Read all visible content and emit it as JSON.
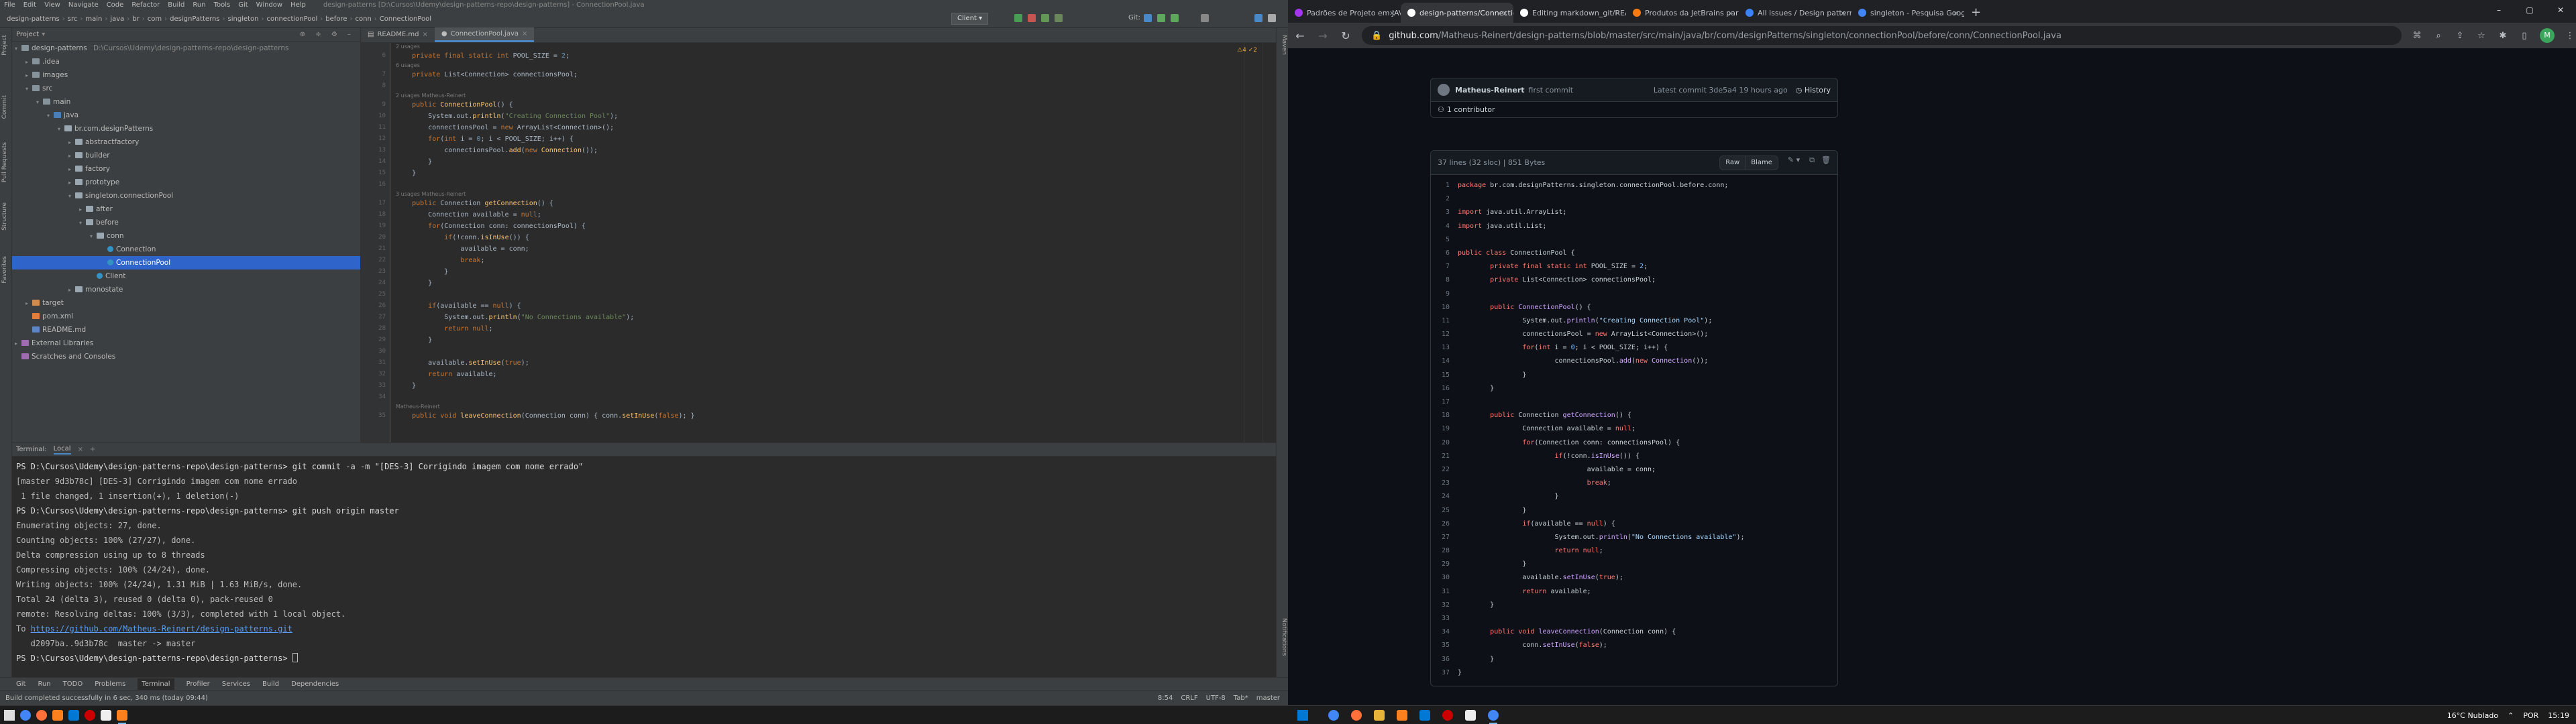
{
  "ide": {
    "menu": [
      "File",
      "Edit",
      "View",
      "Navigate",
      "Code",
      "Refactor",
      "Build",
      "Run",
      "Tools",
      "Git",
      "Window",
      "Help"
    ],
    "title": "design-patterns [D:\\Cursos\\Udemy\\design-patterns-repo\\design-patterns] - ConnectionPool.java",
    "breadcrumb": [
      "design-patterns",
      "src",
      "main",
      "java",
      "br",
      "com",
      "designPatterns",
      "singleton",
      "connectionPool",
      "before",
      "conn",
      "ConnectionPool"
    ],
    "run_config": "Client",
    "git_label": "Git:",
    "left_tabs": [
      "Project",
      "Commit",
      "Pull Requests",
      "Structure",
      "Favorites"
    ],
    "right_tabs": [
      "Maven",
      "Notifications"
    ],
    "project_header": "Project",
    "tree": [
      {
        "label": "design-patterns",
        "extra": "D:\\Cursos\\Udemy\\design-patterns-repo\\design-patterns",
        "indent": 0,
        "type": "fold",
        "arrow": "▾"
      },
      {
        "label": ".idea",
        "indent": 1,
        "type": "fold",
        "arrow": "▸"
      },
      {
        "label": "images",
        "indent": 1,
        "type": "fold",
        "arrow": "▸"
      },
      {
        "label": "src",
        "indent": 1,
        "type": "fold",
        "arrow": "▾"
      },
      {
        "label": "main",
        "indent": 2,
        "type": "fold",
        "arrow": "▾"
      },
      {
        "label": "java",
        "indent": 3,
        "type": "fold-src",
        "arrow": "▾"
      },
      {
        "label": "br.com.designPatterns",
        "indent": 4,
        "type": "fold-pkg",
        "arrow": "▾"
      },
      {
        "label": "abstractfactory",
        "indent": 5,
        "type": "fold-pkg",
        "arrow": "▸"
      },
      {
        "label": "builder",
        "indent": 5,
        "type": "fold-pkg",
        "arrow": "▸"
      },
      {
        "label": "factory",
        "indent": 5,
        "type": "fold-pkg",
        "arrow": "▸"
      },
      {
        "label": "prototype",
        "indent": 5,
        "type": "fold-pkg",
        "arrow": "▸"
      },
      {
        "label": "singleton.connectionPool",
        "indent": 5,
        "type": "fold-pkg",
        "arrow": "▾"
      },
      {
        "label": "after",
        "indent": 6,
        "type": "fold-pkg",
        "arrow": "▸"
      },
      {
        "label": "before",
        "indent": 6,
        "type": "fold-pkg",
        "arrow": "▾"
      },
      {
        "label": "conn",
        "indent": 7,
        "type": "fold-pkg",
        "arrow": "▾"
      },
      {
        "label": "Connection",
        "indent": 8,
        "type": "cls",
        "arrow": ""
      },
      {
        "label": "ConnectionPool",
        "indent": 8,
        "type": "cls",
        "arrow": "",
        "selected": true
      },
      {
        "label": "Client",
        "indent": 7,
        "type": "cls",
        "arrow": ""
      },
      {
        "label": "monostate",
        "indent": 5,
        "type": "fold-pkg",
        "arrow": "▸"
      },
      {
        "label": "target",
        "indent": 1,
        "type": "fold-tgt",
        "arrow": "▸"
      },
      {
        "label": "pom.xml",
        "indent": 1,
        "type": "xml",
        "arrow": ""
      },
      {
        "label": "README.md",
        "indent": 1,
        "type": "md",
        "arrow": ""
      },
      {
        "label": "External Libraries",
        "indent": 0,
        "type": "lib",
        "arrow": "▸"
      },
      {
        "label": "Scratches and Consoles",
        "indent": 0,
        "type": "lib",
        "arrow": ""
      }
    ],
    "editor_tabs": [
      {
        "label": "README.md",
        "active": false
      },
      {
        "label": "ConnectionPool.java",
        "active": true
      }
    ],
    "inspections": "⚠4 ✓2",
    "terminal": {
      "tabs": [
        "Terminal:",
        "Local"
      ],
      "lines": [
        "PS D:\\Cursos\\Udemy\\design-patterns-repo\\design-patterns> git commit -a -m \"[DES-3] Corrigindo imagem com nome errado\"",
        "[master 9d3b78c] [DES-3] Corrigindo imagem com nome errado",
        " 1 file changed, 1 insertion(+), 1 deletion(-)",
        "PS D:\\Cursos\\Udemy\\design-patterns-repo\\design-patterns> git push origin master",
        "Enumerating objects: 27, done.",
        "Counting objects: 100% (27/27), done.",
        "Delta compression using up to 8 threads",
        "Compressing objects: 100% (24/24), done.",
        "Writing objects: 100% (24/24), 1.31 MiB | 1.63 MiB/s, done.",
        "Total 24 (delta 3), reused 0 (delta 0), pack-reused 0",
        "remote: Resolving deltas: 100% (3/3), completed with 1 local object.",
        "",
        "   d2097ba..9d3b78c  master -> master",
        "PS D:\\Cursos\\Udemy\\design-patterns-repo\\design-patterns> "
      ],
      "to_prefix": "To ",
      "to_link": "https://github.com/Matheus-Reinert/design-patterns.git"
    },
    "bottom_tools": [
      "Git",
      "Run",
      "TODO",
      "Problems",
      "Terminal",
      "Profiler",
      "Services",
      "Build",
      "Dependencies"
    ],
    "status": {
      "message": "Build completed successfully in 6 sec, 340 ms (today 09:44)",
      "pos": "8:54",
      "eol": "CRLF",
      "enc": "UTF-8",
      "indent": "Tab*",
      "branch": "master"
    }
  },
  "browser": {
    "tabs": [
      {
        "label": "Padrões de Projeto em JAVA",
        "color": "#a435f0",
        "active": false
      },
      {
        "label": "design-patterns/Connection...",
        "color": "#ffffff",
        "active": true
      },
      {
        "label": "Editing markdown_git/README...",
        "color": "#ffffff",
        "active": false
      },
      {
        "label": "Produtos da JetBrains para...",
        "color": "#f97a12",
        "active": false
      },
      {
        "label": "All issues / Design patterns",
        "color": "#3b82f6",
        "active": false
      },
      {
        "label": "singleton - Pesquisa Google",
        "color": "#4285f4",
        "active": false
      }
    ],
    "url_host": "github.com",
    "url_path": "/Matheus-Reinert/design-patterns/blob/master/src/main/java/br/com/designPatterns/singleton/connectionPool/before/conn/ConnectionPool.java",
    "profile_initial": "M",
    "commit": {
      "author": "Matheus-Reinert",
      "message": "first commit",
      "latest": "Latest commit 3de5a4 19 hours ago",
      "history": "History"
    },
    "contributors": "1 contributor",
    "file_info": "37 lines (32 sloc)   |   851 Bytes",
    "raw": "Raw",
    "blame": "Blame"
  },
  "code_lines": [
    {
      "n": 1,
      "t": "package br.com.designPatterns.singleton.connectionPool.before.conn;"
    },
    {
      "n": 2,
      "t": ""
    },
    {
      "n": 3,
      "t": "import java.util.ArrayList;"
    },
    {
      "n": 4,
      "t": "import java.util.List;"
    },
    {
      "n": 5,
      "t": ""
    },
    {
      "n": 6,
      "t": "public class ConnectionPool {"
    },
    {
      "n": 7,
      "t": "        private final static int POOL_SIZE = 2;"
    },
    {
      "n": 8,
      "t": "        private List<Connection> connectionsPool;"
    },
    {
      "n": 9,
      "t": ""
    },
    {
      "n": 10,
      "t": "        public ConnectionPool() {"
    },
    {
      "n": 11,
      "t": "                System.out.println(\"Creating Connection Pool\");"
    },
    {
      "n": 12,
      "t": "                connectionsPool = new ArrayList<Connection>();"
    },
    {
      "n": 13,
      "t": "                for(int i = 0; i < POOL_SIZE; i++) {"
    },
    {
      "n": 14,
      "t": "                        connectionsPool.add(new Connection());"
    },
    {
      "n": 15,
      "t": "                }"
    },
    {
      "n": 16,
      "t": "        }"
    },
    {
      "n": 17,
      "t": ""
    },
    {
      "n": 18,
      "t": "        public Connection getConnection() {"
    },
    {
      "n": 19,
      "t": "                Connection available = null;"
    },
    {
      "n": 20,
      "t": "                for(Connection conn: connectionsPool) {"
    },
    {
      "n": 21,
      "t": "                        if(!conn.isInUse()) {"
    },
    {
      "n": 22,
      "t": "                                available = conn;"
    },
    {
      "n": 23,
      "t": "                                break;"
    },
    {
      "n": 24,
      "t": "                        }"
    },
    {
      "n": 25,
      "t": "                }"
    },
    {
      "n": 26,
      "t": "                if(available == null) {"
    },
    {
      "n": 27,
      "t": "                        System.out.println(\"No Connections available\");"
    },
    {
      "n": 28,
      "t": "                        return null;"
    },
    {
      "n": 29,
      "t": "                }"
    },
    {
      "n": 30,
      "t": "                available.setInUse(true);"
    },
    {
      "n": 31,
      "t": "                return available;"
    },
    {
      "n": 32,
      "t": "        }"
    },
    {
      "n": 33,
      "t": ""
    },
    {
      "n": 34,
      "t": "        public void leaveConnection(Connection conn) {"
    },
    {
      "n": 35,
      "t": "                conn.setInUse(false);"
    },
    {
      "n": 36,
      "t": "        }"
    },
    {
      "n": 37,
      "t": "}"
    }
  ],
  "ide_code": [
    {
      "n": 6,
      "t": "    private final static int POOL_SIZE = 2;",
      "hint": "2 usages"
    },
    {
      "n": 7,
      "t": "    private List<Connection> connectionsPool;",
      "hint": "6 usages"
    },
    {
      "n": 8,
      "t": ""
    },
    {
      "n": 9,
      "t": "    public ConnectionPool() {",
      "hint": "2 usages   Matheus-Reinert"
    },
    {
      "n": 10,
      "t": "        System.out.println(\"Creating Connection Pool\");"
    },
    {
      "n": 11,
      "t": "        connectionsPool = new ArrayList<Connection>();"
    },
    {
      "n": 12,
      "t": "        for(int i = 0; i < POOL_SIZE; i++) {"
    },
    {
      "n": 13,
      "t": "            connectionsPool.add(new Connection());"
    },
    {
      "n": 14,
      "t": "        }"
    },
    {
      "n": 15,
      "t": "    }"
    },
    {
      "n": 16,
      "t": ""
    },
    {
      "n": 17,
      "t": "    public Connection getConnection() {",
      "hint": "3 usages   Matheus-Reinert"
    },
    {
      "n": 18,
      "t": "        Connection available = null;"
    },
    {
      "n": 19,
      "t": "        for(Connection conn: connectionsPool) {"
    },
    {
      "n": 20,
      "t": "            if(!conn.isInUse()) {"
    },
    {
      "n": 21,
      "t": "                available = conn;"
    },
    {
      "n": 22,
      "t": "                break;"
    },
    {
      "n": 23,
      "t": "            }"
    },
    {
      "n": 24,
      "t": "        }"
    },
    {
      "n": 25,
      "t": ""
    },
    {
      "n": 26,
      "t": "        if(available == null) {"
    },
    {
      "n": 27,
      "t": "            System.out.println(\"No Connections available\");"
    },
    {
      "n": 28,
      "t": "            return null;"
    },
    {
      "n": 29,
      "t": "        }"
    },
    {
      "n": 30,
      "t": ""
    },
    {
      "n": 31,
      "t": "        available.setInUse(true);"
    },
    {
      "n": 32,
      "t": "        return available;"
    },
    {
      "n": 33,
      "t": "    }"
    },
    {
      "n": 34,
      "t": ""
    },
    {
      "n": 35,
      "t": "    public void leaveConnection(Connection conn) { conn.setInUse(false); }",
      "hint": "Matheus-Reinert"
    }
  ],
  "taskbar": {
    "weather": "16°C  Nublado",
    "lang": "POR",
    "time": "15:19"
  }
}
